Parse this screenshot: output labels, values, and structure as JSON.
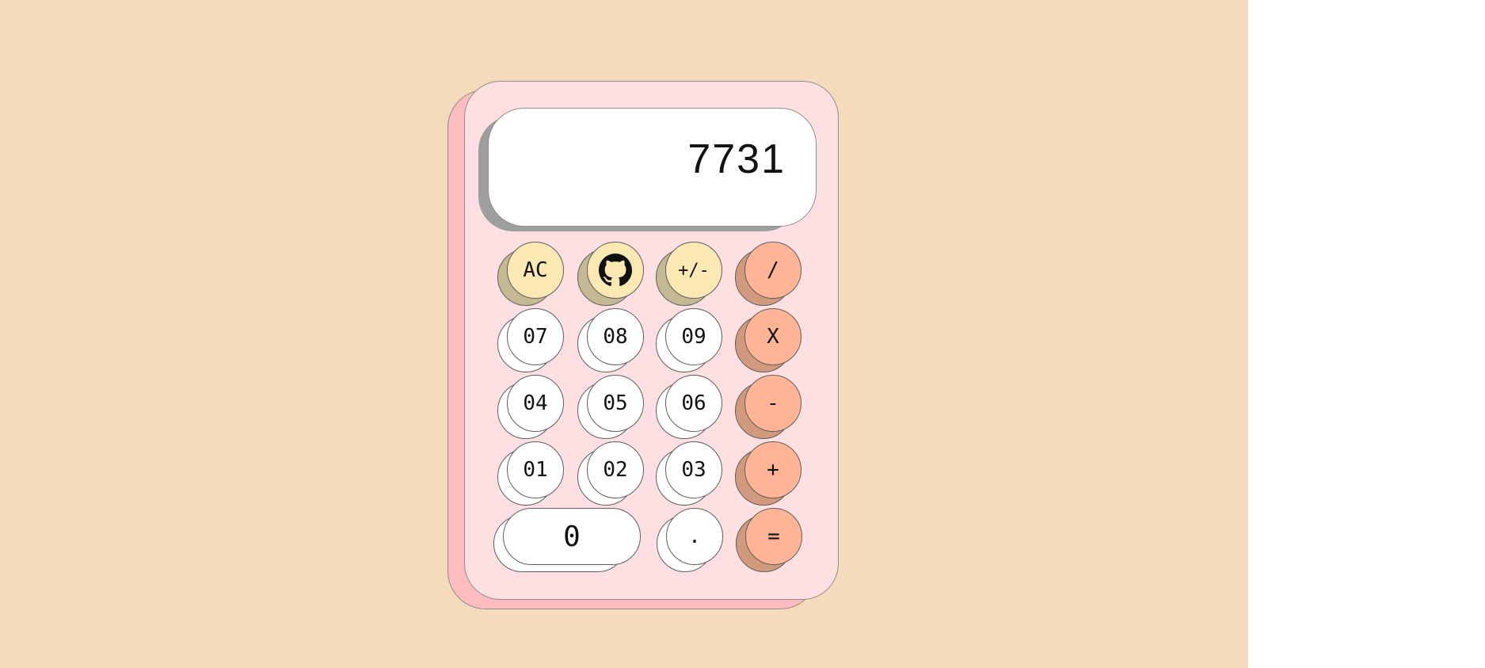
{
  "display": {
    "value": "7731"
  },
  "keys": {
    "ac": "AC",
    "github_icon": "github-icon",
    "sign": "+/-",
    "divide": "/",
    "n7": "07",
    "n8": "08",
    "n9": "09",
    "multiply": "X",
    "n4": "04",
    "n5": "05",
    "n6": "06",
    "subtract": "-",
    "n1": "01",
    "n2": "02",
    "n3": "03",
    "add": "+",
    "n0": "0",
    "dot": ".",
    "equals": "="
  },
  "colors": {
    "page_background": "#f5dbbb",
    "calculator_body": "#fee0e2",
    "function_key": "#fbe8b3",
    "operator_key": "#ffb595",
    "number_key": "#ffffff"
  }
}
